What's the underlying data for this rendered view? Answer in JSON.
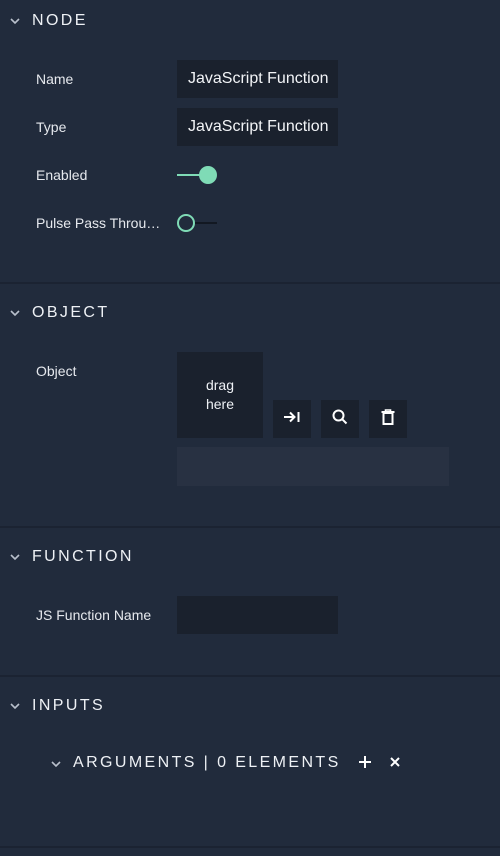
{
  "sections": {
    "node": {
      "title": "NODE",
      "fields": {
        "name": {
          "label": "Name",
          "value": "JavaScript Function"
        },
        "type": {
          "label": "Type",
          "value": "JavaScript Function"
        },
        "enabled": {
          "label": "Enabled",
          "on": true
        },
        "pulse_pass_through": {
          "label": "Pulse Pass Throu…",
          "on": false
        }
      }
    },
    "object": {
      "title": "OBJECT",
      "label": "Object",
      "drop_line1": "drag",
      "drop_line2": "here",
      "buttons": [
        "link-icon",
        "search-icon",
        "trash-icon"
      ],
      "path_value": ""
    },
    "function": {
      "title": "FUNCTION",
      "js_function_name": {
        "label": "JS Function Name",
        "value": ""
      }
    },
    "inputs": {
      "title": "INPUTS",
      "arguments": {
        "title": "ARGUMENTS | 0 ELEMENTS"
      }
    }
  },
  "colors": {
    "background": "#212b3c",
    "field": "#1a212d",
    "accent": "#7fdbb6",
    "text": "#e6e9ee"
  }
}
